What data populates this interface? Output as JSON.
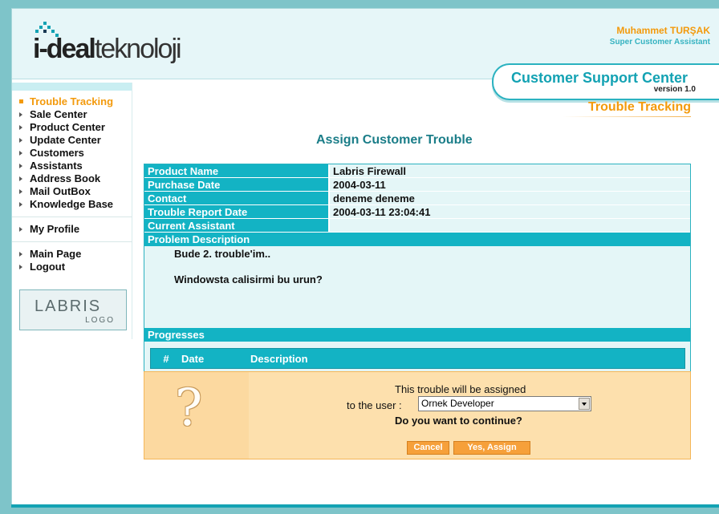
{
  "header": {
    "logo": {
      "part1": "i-deal",
      "part2": "teknoloji"
    },
    "user": {
      "name": "Muhammet TURŞAK",
      "role": "Super Customer Assistant"
    },
    "app": {
      "title": "Customer Support Center",
      "version": "version 1.0"
    }
  },
  "sidebar": {
    "groups": [
      [
        {
          "label": "Trouble Tracking",
          "active": true
        },
        {
          "label": "Sale Center"
        },
        {
          "label": "Product Center"
        },
        {
          "label": "Update Center"
        },
        {
          "label": "Customers"
        },
        {
          "label": "Assistants"
        },
        {
          "label": "Address Book"
        },
        {
          "label": "Mail OutBox"
        },
        {
          "label": "Knowledge Base"
        }
      ],
      [
        {
          "label": "My Profile"
        }
      ],
      [
        {
          "label": "Main Page"
        },
        {
          "label": "Logout"
        }
      ]
    ],
    "partner_logo": {
      "big": "LABRIS",
      "small": "LOGO"
    }
  },
  "section": {
    "title": "Trouble Tracking"
  },
  "page": {
    "title": "Assign Customer Trouble"
  },
  "details": {
    "rows": [
      {
        "label": "Product Name",
        "value": "Labris Firewall"
      },
      {
        "label": "Purchase Date",
        "value": "2004-03-11"
      },
      {
        "label": "Contact",
        "value": "deneme deneme"
      },
      {
        "label": "Trouble Report Date",
        "value": "2004-03-11 23:04:41"
      },
      {
        "label": "Current Assistant",
        "value": ""
      }
    ],
    "problem_label": "Problem Description",
    "problem_lines": [
      "Bude 2. trouble'im..",
      "",
      "Windowsta calisirmi bu urun?"
    ],
    "progress_label": "Progresses",
    "progress_columns": [
      "#",
      "Date",
      "Description"
    ]
  },
  "confirm": {
    "line1": "This trouble will be assigned",
    "line2": "to the user :",
    "selected_user": "Ornek Developer",
    "question": "Do you want to continue?",
    "cancel_label": "Cancel",
    "assign_label": "Yes, Assign"
  },
  "colors": {
    "accent_orange": "#f39a0c",
    "accent_teal": "#13b3c4",
    "title_teal": "#1a7d88"
  }
}
